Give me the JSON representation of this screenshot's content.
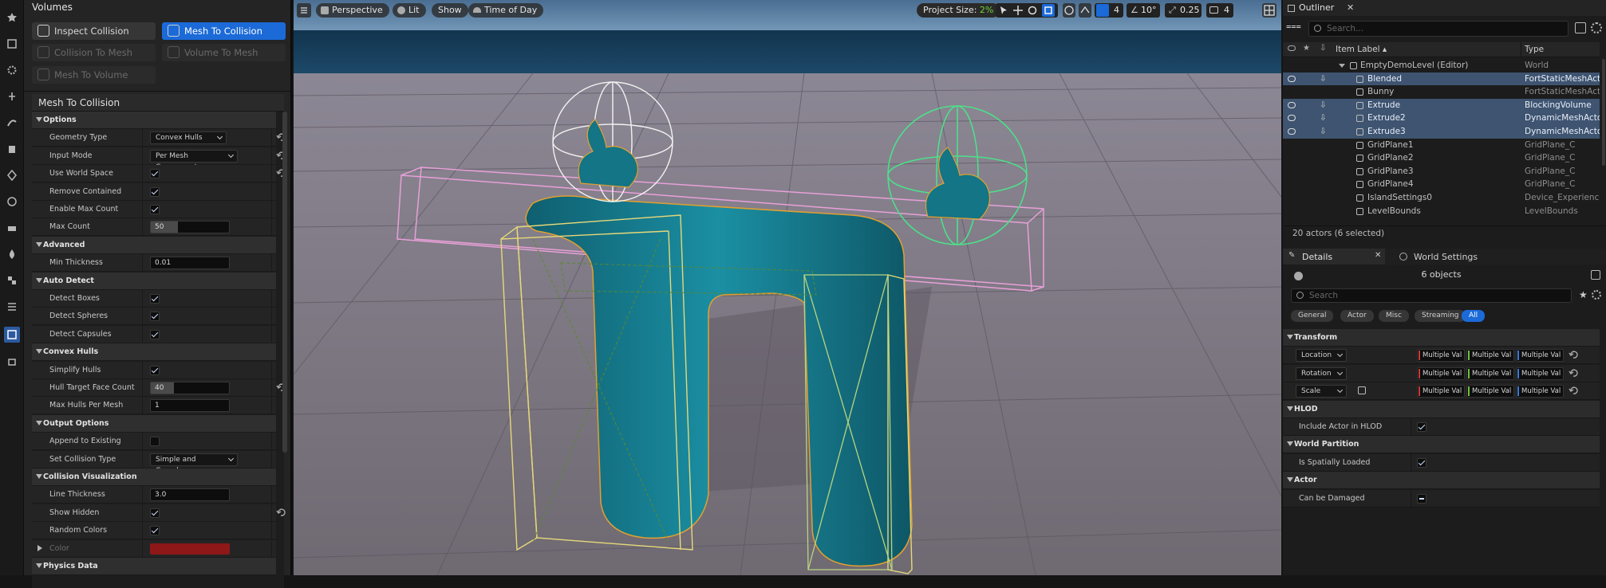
{
  "left_panel": {
    "volumes_title": "Volumes",
    "tools": [
      {
        "label": "Inspect Collision",
        "state": "normal"
      },
      {
        "label": "Mesh To Collision",
        "state": "active"
      },
      {
        "label": "Collision To Mesh",
        "state": "disabled"
      },
      {
        "label": "Volume To Mesh",
        "state": "disabled"
      },
      {
        "label": "Mesh To Volume",
        "state": "disabled"
      }
    ],
    "details_title": "Mesh To Collision",
    "rows": [
      {
        "kind": "cat",
        "label": "Options"
      },
      {
        "kind": "dd",
        "label": "Geometry Type",
        "value": "Convex Hulls",
        "reset": true
      },
      {
        "kind": "dd",
        "label": "Input Mode",
        "value": "Per Mesh Component",
        "reset": true
      },
      {
        "kind": "cb",
        "label": "Use World Space",
        "value": true,
        "reset": true
      },
      {
        "kind": "cb",
        "label": "Remove Contained",
        "value": true
      },
      {
        "kind": "cb",
        "label": "Enable Max Count",
        "value": true
      },
      {
        "kind": "num",
        "label": "Max Count",
        "value": "50",
        "fill": 0.35
      },
      {
        "kind": "cat",
        "label": "Advanced"
      },
      {
        "kind": "num",
        "label": "Min Thickness",
        "value": "0.01",
        "fill": 0
      },
      {
        "kind": "cat",
        "label": "Auto Detect"
      },
      {
        "kind": "cb",
        "label": "Detect Boxes",
        "value": true
      },
      {
        "kind": "cb",
        "label": "Detect Spheres",
        "value": true
      },
      {
        "kind": "cb",
        "label": "Detect Capsules",
        "value": true
      },
      {
        "kind": "cat",
        "label": "Convex Hulls"
      },
      {
        "kind": "cb",
        "label": "Simplify Hulls",
        "value": true
      },
      {
        "kind": "num",
        "label": "Hull Target Face Count",
        "value": "40",
        "fill": 0.3,
        "reset": true
      },
      {
        "kind": "num",
        "label": "Max Hulls Per Mesh",
        "value": "1",
        "fill": 0
      },
      {
        "kind": "cat",
        "label": "Output Options"
      },
      {
        "kind": "cb",
        "label": "Append to Existing",
        "value": false
      },
      {
        "kind": "dd",
        "label": "Set Collision Type",
        "value": "Simple and Complex"
      },
      {
        "kind": "cat",
        "label": "Collision Visualization"
      },
      {
        "kind": "num",
        "label": "Line Thickness",
        "value": "3.0",
        "fill": 0
      },
      {
        "kind": "cb",
        "label": "Show Hidden",
        "value": true,
        "reset": true
      },
      {
        "kind": "cb",
        "label": "Random Colors",
        "value": true
      },
      {
        "kind": "color",
        "label": "Color",
        "value": "#8e1818"
      },
      {
        "kind": "cat",
        "label": "Physics Data"
      }
    ]
  },
  "viewport": {
    "perspective_label": "Perspective",
    "lit_label": "Lit",
    "show_label": "Show",
    "time_of_day_label": "Time of Day",
    "project_size_label": "Project Size:",
    "project_size_value": "2%",
    "grid_snap": "4",
    "angle_snap": "10°",
    "scale_snap": "0.25",
    "camera_speed": "4"
  },
  "outliner": {
    "title": "Outliner",
    "search_placeholder": "Search...",
    "col_label": "Item Label",
    "col_type": "Type",
    "rows": [
      {
        "name": "EmptyDemoLevel (Editor)",
        "type": "World",
        "sel": false,
        "level": 0
      },
      {
        "name": "Blended",
        "type": "FortStaticMeshActor",
        "sel": true,
        "level": 1
      },
      {
        "name": "Bunny",
        "type": "FortStaticMeshActor",
        "sel": false,
        "level": 1
      },
      {
        "name": "Extrude",
        "type": "BlockingVolume",
        "sel": true,
        "level": 1
      },
      {
        "name": "Extrude2",
        "type": "DynamicMeshActor",
        "sel": true,
        "level": 1
      },
      {
        "name": "Extrude3",
        "type": "DynamicMeshActor",
        "sel": true,
        "level": 1
      },
      {
        "name": "GridPlane1",
        "type": "GridPlane_C",
        "sel": false,
        "level": 1
      },
      {
        "name": "GridPlane2",
        "type": "GridPlane_C",
        "sel": false,
        "level": 1
      },
      {
        "name": "GridPlane3",
        "type": "GridPlane_C",
        "sel": false,
        "level": 1
      },
      {
        "name": "GridPlane4",
        "type": "GridPlane_C",
        "sel": false,
        "level": 1
      },
      {
        "name": "IslandSettings0",
        "type": "Device_Experience",
        "sel": false,
        "level": 1
      },
      {
        "name": "LevelBounds",
        "type": "LevelBounds",
        "sel": false,
        "level": 1
      }
    ],
    "status": "20 actors (6 selected)"
  },
  "details": {
    "tab_details": "Details",
    "tab_world": "World Settings",
    "objects_label": "6 objects",
    "search_placeholder": "Search",
    "filters": [
      "General",
      "Actor",
      "Misc",
      "Streaming",
      "All"
    ],
    "transform": "Transform",
    "location": "Location",
    "rotation": "Rotation",
    "scale": "Scale",
    "multi": "Multiple Val",
    "hlod": "HLOD",
    "include_hlod": "Include Actor in HLOD",
    "world_partition": "World Partition",
    "spatially_loaded": "Is Spatially Loaded",
    "actor": "Actor",
    "can_be_damaged": "Can be Damaged"
  }
}
